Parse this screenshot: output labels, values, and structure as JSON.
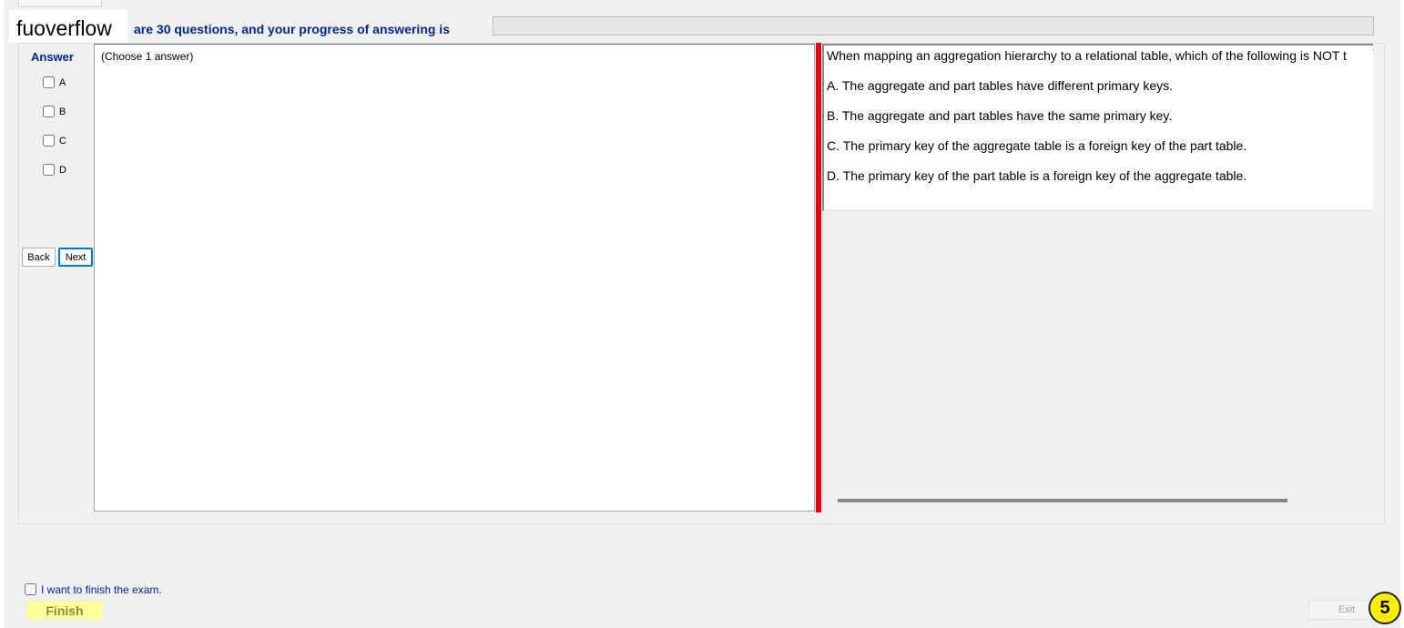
{
  "brand": "fuoverflow",
  "header": {
    "progress_text": "are 30 questions, and your progress of answering is",
    "progress_value": 0
  },
  "answer_panel": {
    "title": "Answer",
    "options": [
      "A",
      "B",
      "C",
      "D"
    ],
    "back_label": "Back",
    "next_label": "Next",
    "hint": "(Choose 1 answer)"
  },
  "question": {
    "text": "When mapping an aggregation hierarchy to a relational table, which of the following is NOT t",
    "choices": [
      "A.  The aggregate and part tables have different primary keys.",
      "B.  The aggregate and part tables have the same primary key.",
      "C.  The primary key of the aggregate table is a foreign key of the part table.",
      "D.  The primary key of the part table is a foreign key of the aggregate table."
    ]
  },
  "footer": {
    "finish_checkbox_label": "I want to finish the exam.",
    "finish_label": "Finish",
    "exit_label": "Exit",
    "badge": "5"
  },
  "colors": {
    "accent_blue": "#00249c",
    "splitter_red": "#e20a0a",
    "finish_yellow": "#ffff99",
    "badge_yellow": "#ffee00"
  }
}
